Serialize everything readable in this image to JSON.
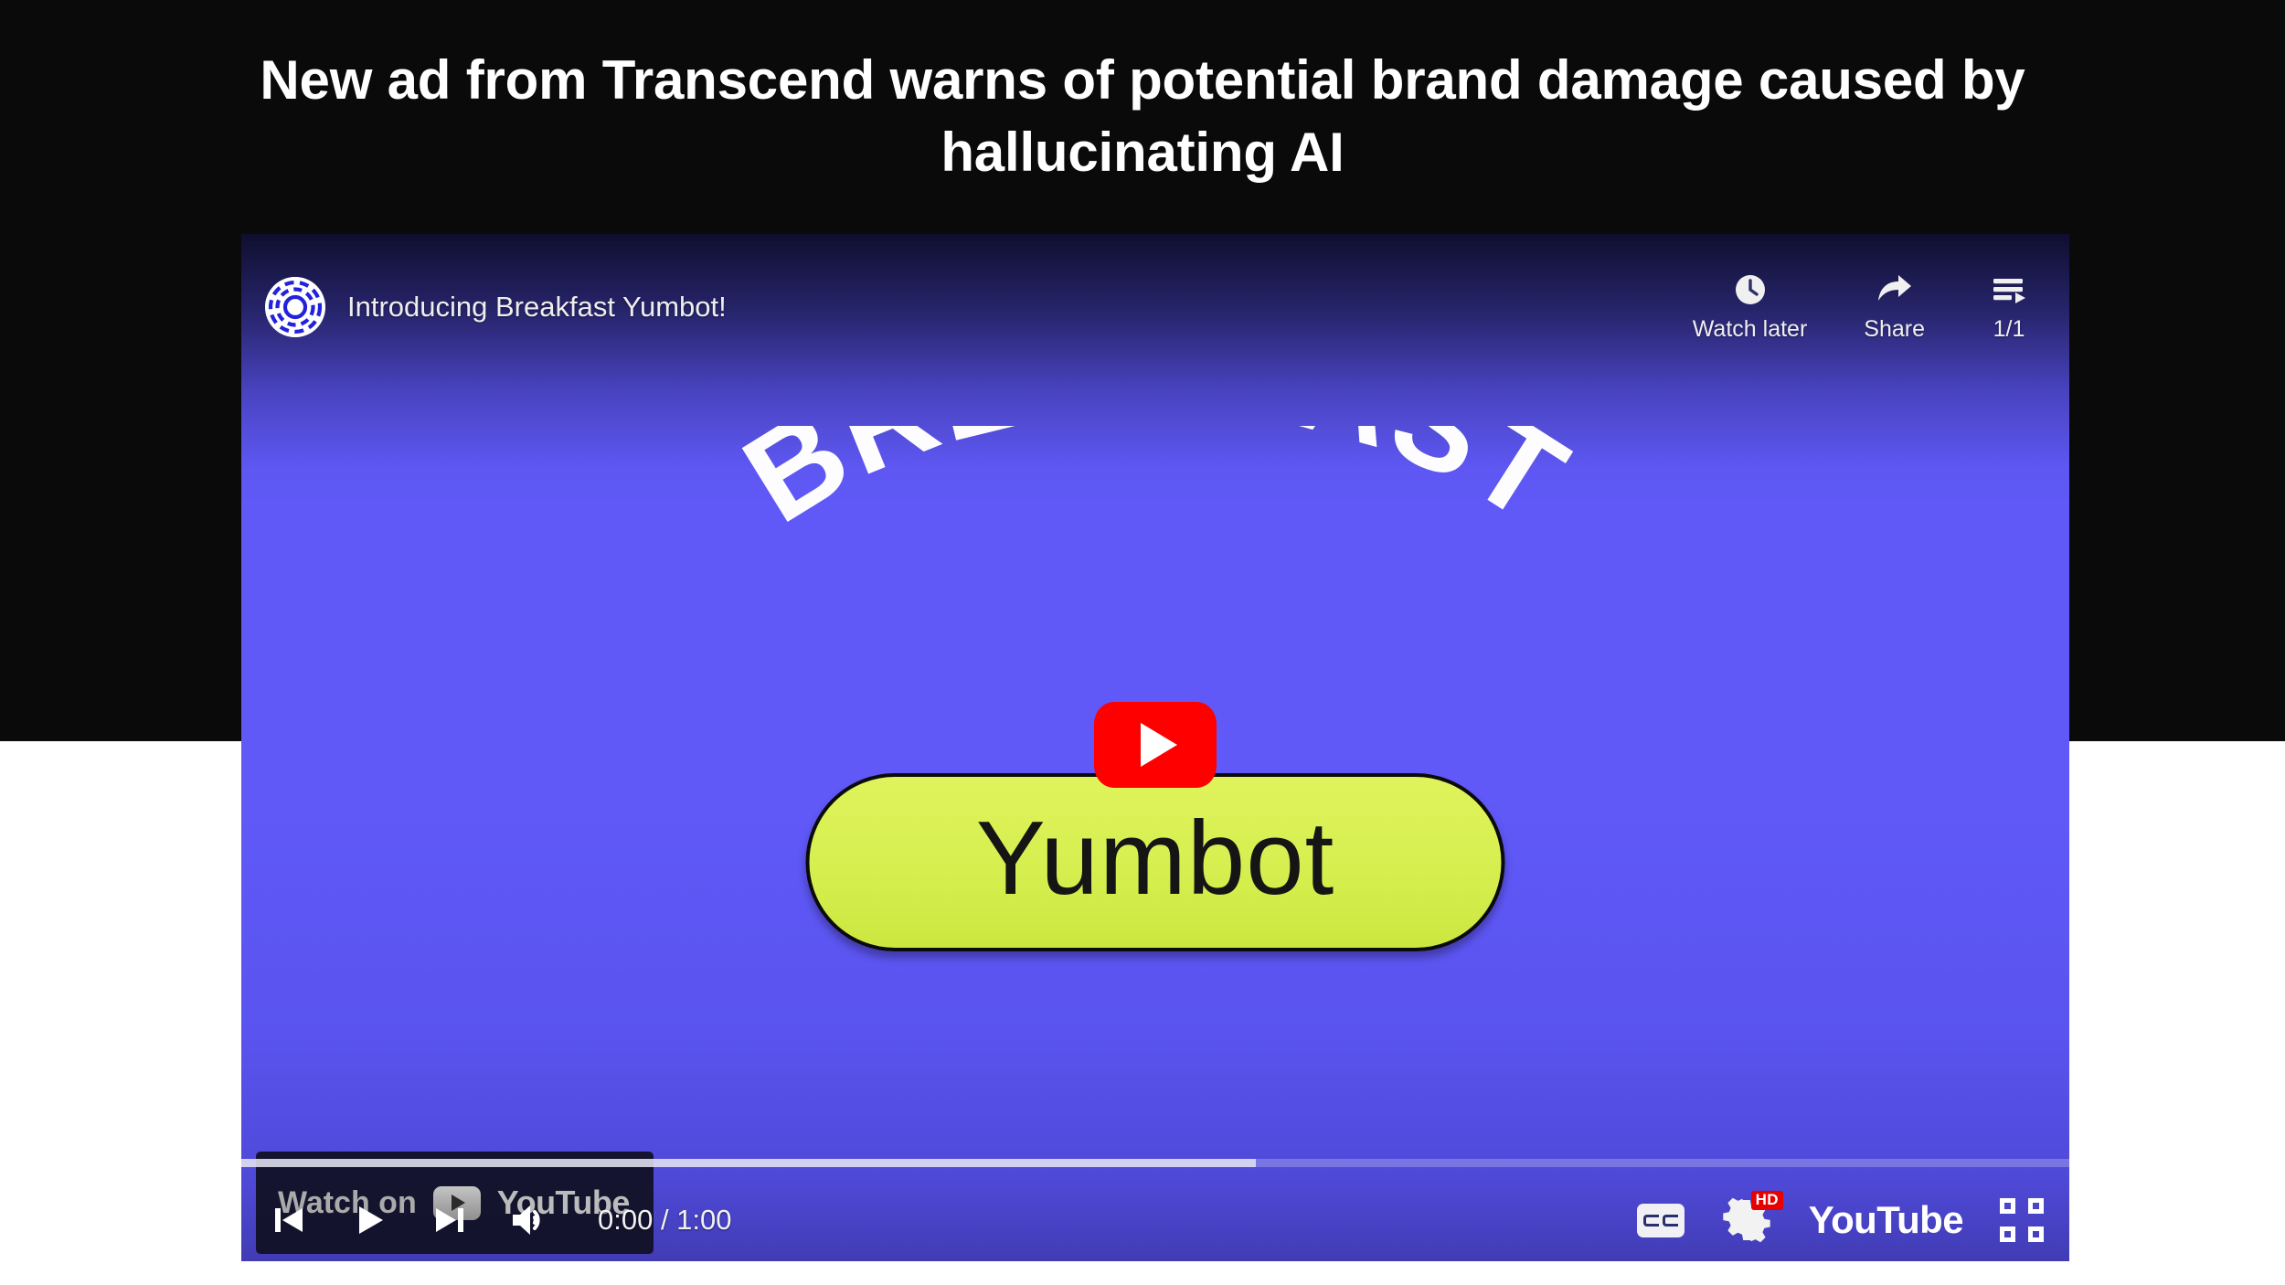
{
  "page": {
    "headline": "New ad from Transcend warns of potential brand damage caused by hallucinating AI",
    "background_band_color": "#0a0a0a",
    "page_background_color": "#ffffff"
  },
  "player": {
    "video_title": "Introducing Breakfast Yumbot!",
    "avatar_icon": "concentric-dashed-rings-avatar",
    "background_accent": "#6059f8",
    "header_actions": [
      {
        "label": "Watch later",
        "icon": "clock-icon"
      },
      {
        "label": "Share",
        "icon": "share-arrow-icon"
      },
      {
        "label": "1/1",
        "icon": "playlist-icon"
      }
    ],
    "big_play_button": {
      "icon": "play-triangle-icon",
      "color": "#ff0000"
    },
    "artwork": {
      "arch_text": "BREAKFAST",
      "arch_text_color": "#fdfdff",
      "pill_text": "Yumbot",
      "pill_fill": "#d6ef4f",
      "pill_text_color": "#151515",
      "pill_border_color": "#0b0b0b"
    },
    "watch_badge": {
      "prefix": "Watch on",
      "wordmark": "YouTube",
      "icon": "youtube-chip-icon"
    },
    "progress": {
      "played_percent": 0,
      "buffered_percent": 55.5
    },
    "controls_left": [
      {
        "name": "previous-track",
        "icon": "previous-track-icon"
      },
      {
        "name": "play",
        "icon": "play-icon"
      },
      {
        "name": "next-track",
        "icon": "next-track-icon"
      },
      {
        "name": "volume",
        "icon": "volume-high-icon"
      }
    ],
    "time_display": "0:00 / 1:00",
    "current_time": "0:00",
    "duration": "1:00",
    "controls_right": [
      {
        "name": "captions",
        "icon": "cc-icon",
        "label": "CC"
      },
      {
        "name": "settings",
        "icon": "gear-icon",
        "badge": "HD"
      },
      {
        "name": "youtube-link",
        "icon": "youtube-wordmark",
        "label": "YouTube"
      },
      {
        "name": "fullscreen",
        "icon": "fullscreen-icon"
      }
    ],
    "settings_badge": "HD",
    "youtube_wordmark": "YouTube"
  }
}
